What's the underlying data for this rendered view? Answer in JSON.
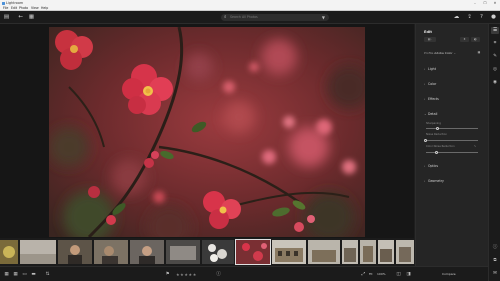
{
  "window": {
    "title": "Lightroom",
    "minimize": "–",
    "maximize": "☐",
    "close": "✕"
  },
  "menu": [
    "File",
    "Edit",
    "Photo",
    "View",
    "Help"
  ],
  "toolbar": {
    "search_placeholder": "Search All Photos"
  },
  "edit_panel": {
    "title": "Edit",
    "profile_label": "Profile",
    "profile_value": "Adobe Color",
    "sections": [
      "Light",
      "Color",
      "Effects",
      "Detail",
      "Optics",
      "Geometry"
    ],
    "detail_sub": [
      "Sharpening",
      "Noise Reduction",
      "Color Noise Reduction"
    ]
  },
  "bottom_bar": {
    "zoom": "100%",
    "zoom_menu": "Fit",
    "compare_label": "Compare"
  },
  "accent": "#e03c4a"
}
